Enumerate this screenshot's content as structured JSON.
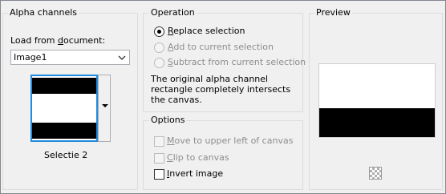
{
  "alpha_channels": {
    "group_title": "Alpha channels",
    "load_label": "Load from document:",
    "selected_document": "Image1",
    "channel_name": "Selectie 2"
  },
  "operation": {
    "group_title": "Operation",
    "options": [
      {
        "label": "Replace selection",
        "checked": true,
        "enabled": true
      },
      {
        "label": "Add to current selection",
        "checked": false,
        "enabled": false
      },
      {
        "label": "Subtract from current selection",
        "checked": false,
        "enabled": false
      }
    ],
    "description": "The original alpha channel rectangle completely intersects the canvas."
  },
  "options": {
    "group_title": "Options",
    "items": [
      {
        "label": "Move to upper left of canvas",
        "checked": false,
        "enabled": false
      },
      {
        "label": "Clip to canvas",
        "checked": false,
        "enabled": false
      },
      {
        "label": "Invert image",
        "checked": false,
        "enabled": true
      }
    ]
  },
  "preview": {
    "group_title": "Preview"
  },
  "icons": {
    "dropdown": "chevron-down-icon",
    "channel_menu": "triangle-down-icon",
    "transparency": "checkerboard-icon"
  },
  "colors": {
    "selection_border": "#1e8bde",
    "disabled_text": "#8d8d8d"
  }
}
